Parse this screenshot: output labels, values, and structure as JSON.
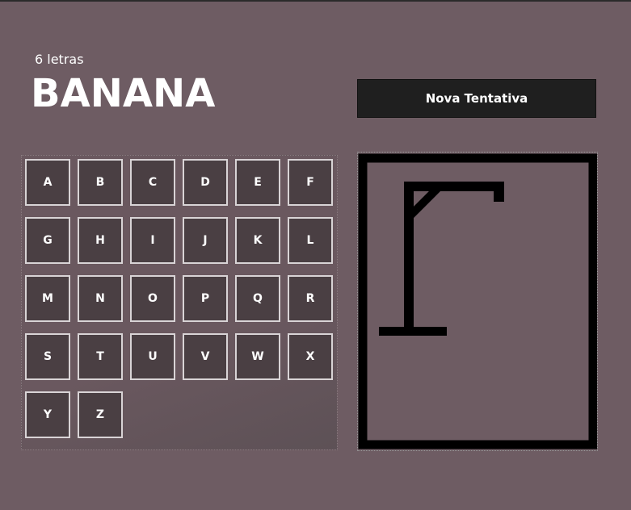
{
  "word_count": "6 letras",
  "word": "BANANA",
  "new_try_label": "Nova Tentativa",
  "keys": [
    "A",
    "B",
    "C",
    "D",
    "E",
    "F",
    "G",
    "H",
    "I",
    "J",
    "K",
    "L",
    "M",
    "N",
    "O",
    "P",
    "Q",
    "R",
    "S",
    "T",
    "U",
    "V",
    "W",
    "X",
    "Y",
    "Z"
  ],
  "colors": {
    "background": "#6e5c63",
    "key_fill": "#4a3f43",
    "key_border": "#d9d4d6",
    "button_fill": "#1f1f1f",
    "gallows": "#000000"
  }
}
